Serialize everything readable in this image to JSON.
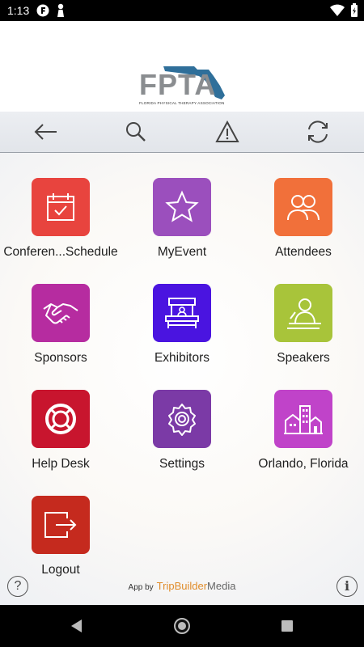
{
  "status_bar": {
    "time": "1:13"
  },
  "header": {
    "logo_text": "FPTA",
    "logo_subtitle": "FLORIDA PHYSICAL THERAPY ASSOCIATION"
  },
  "toolbar": {
    "icons": [
      "back-arrow-icon",
      "search-icon",
      "warning-icon",
      "refresh-icon"
    ]
  },
  "tiles": [
    {
      "label": "Conferen...Schedule",
      "color": "#e8443e",
      "icon": "calendar-check-icon"
    },
    {
      "label": "MyEvent",
      "color": "#9b4fbd",
      "icon": "star-icon"
    },
    {
      "label": "Attendees",
      "color": "#f1703a",
      "icon": "people-icon"
    },
    {
      "label": "Sponsors",
      "color": "#b62ca0",
      "icon": "handshake-icon"
    },
    {
      "label": "Exhibitors",
      "color": "#4a14e0",
      "icon": "exhibit-booth-icon"
    },
    {
      "label": "Speakers",
      "color": "#a8c43a",
      "icon": "speaker-podium-icon"
    },
    {
      "label": "Help Desk",
      "color": "#c8152e",
      "icon": "lifebuoy-icon"
    },
    {
      "label": "Settings",
      "color": "#7b3aa6",
      "icon": "gear-icon"
    },
    {
      "label": "Orlando, Florida",
      "color": "#c043c9",
      "icon": "city-buildings-icon"
    },
    {
      "label": "Logout",
      "color": "#c52a1e",
      "icon": "logout-icon"
    }
  ],
  "footer": {
    "app_by": "App by",
    "brand_name": "TripBuilder",
    "brand_suffix": "Media"
  }
}
